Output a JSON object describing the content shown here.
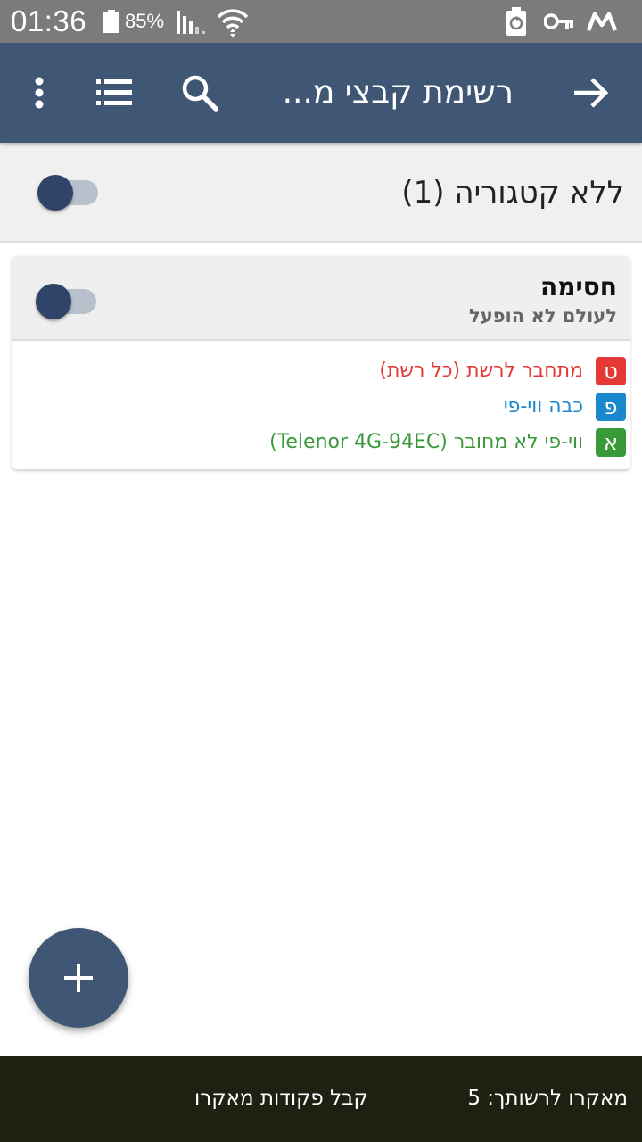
{
  "status_bar": {
    "time": "01:36",
    "battery_percent": "85%",
    "icons": [
      "battery-icon",
      "signal-icon",
      "wifi-icon",
      "recycle-icon",
      "key-icon",
      "macrodroid-icon"
    ]
  },
  "toolbar": {
    "title": "רשימת קבצי מ...",
    "icons": [
      "more-vert-icon",
      "list-icon",
      "search-icon",
      "arrow-forward-icon"
    ],
    "background": "#3f5774"
  },
  "category": {
    "title": "ללא קטגוריה (1)",
    "toggle_on": false
  },
  "macro": {
    "name": "חסימה",
    "status": "לעולם לא הופעל",
    "toggle_on": false,
    "rows": [
      {
        "badge": "ט",
        "text": "מתחבר לרשת (כל רשת)",
        "color": "#e53935"
      },
      {
        "badge": "פ",
        "text": "כבה ווי-פי",
        "color": "#1a88cc"
      },
      {
        "badge": "א",
        "text": "ווי-פי לא מחובר (Telenor 4G-94EC)",
        "color": "#3a9a3a"
      }
    ]
  },
  "fab": {
    "icon": "plus-icon"
  },
  "bottom_bar": {
    "macro_count": "מאקרו לרשותך: 5",
    "action": "קבל פקודות מאקרו"
  }
}
